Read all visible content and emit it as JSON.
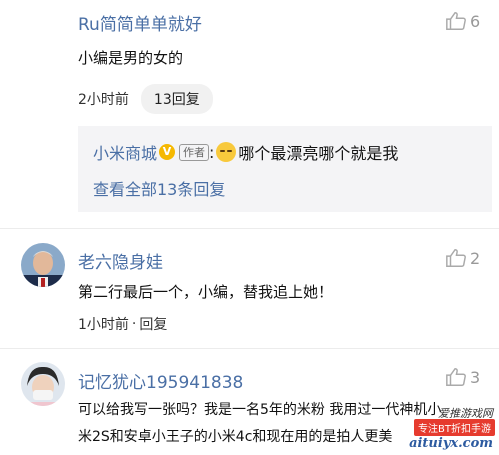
{
  "comments": [
    {
      "author": "Ru简简单单就好",
      "likes": "6",
      "text": "小编是男的女的",
      "time": "2小时前",
      "reply_count": "13回复"
    },
    {
      "author": "老六隐身娃",
      "likes": "2",
      "text": "第二行最后一个，小编，替我追上她！",
      "time": "1小时前",
      "reply_label": "回复"
    },
    {
      "author": "记忆犹心195941838",
      "likes": "3",
      "text_line1": "可以给我写一张吗？我是一名5年的米粉 我用过一代神机小",
      "text_line2": "米2S和安卓小王子的小米4c和现在用的是拍人更美"
    }
  ],
  "reply_preview": {
    "author": "小米商城",
    "verified_badge": "V",
    "author_tag": "作者",
    "separator": ":",
    "text": "哪个最漂亮哪个就是我",
    "view_all": "查看全部13条回复"
  },
  "separator_dot": "·",
  "watermark": {
    "top": "爱推游戏网",
    "badge": "专注BT折扣手游",
    "url": "aituiyx.com"
  },
  "colors": {
    "author_link": "#4a6fa5",
    "reply_box_bg": "#f4f4f6",
    "verified": "#f5b800"
  }
}
